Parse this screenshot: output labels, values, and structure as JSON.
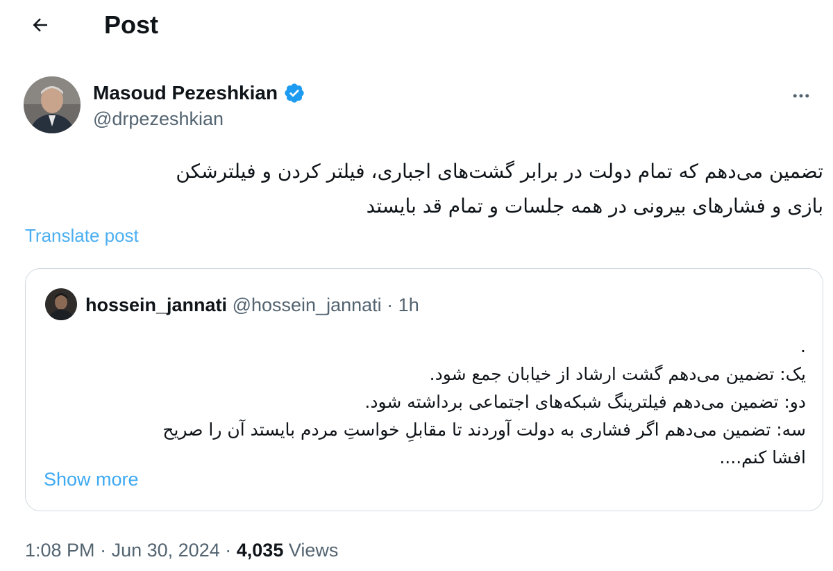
{
  "header": {
    "title": "Post",
    "back_icon": "arrow-left-icon"
  },
  "author": {
    "name": "Masoud Pezeshkian",
    "handle": "@drpezeshkian",
    "verified_icon": "verified-badge-icon",
    "verified_color": "#1d9bf0",
    "more_icon": "more-horizontal-icon"
  },
  "post": {
    "lines": [
      "تضمین می‌دهم که تمام دولت در برابر  گشت‌های اجباری، فیلتر کردن و فیلترشکن",
      "بازی و فشارهای بیرونی در همه جلسات و تمام قد بایستد"
    ],
    "translate_label": "Translate post"
  },
  "quote": {
    "name": "hossein_jannati",
    "handle": "@hossein_jannati",
    "separator": "·",
    "time": "1h",
    "lines": [
      ".",
      "یک: تضمین می‌دهم گشت ارشاد از خیابان جمع شود.",
      "دو: تضمین می‌دهم فیلترینگ شبکه‌های اجتماعی برداشته شود.",
      "سه: تضمین می‌دهم اگر فشاری به دولت آوردند تا مقابلِ خواستِ مردم بایستد آن را صریح",
      "افشا کنم...."
    ],
    "show_more_label": "Show more"
  },
  "footer": {
    "time": "1:08 PM",
    "separator1": "·",
    "date": "Jun 30, 2024",
    "separator2": "·",
    "views_count": "4,035",
    "views_label": "Views"
  },
  "colors": {
    "accent": "#1d9bf0",
    "secondary_text": "#536471",
    "border": "#cfd9de"
  }
}
